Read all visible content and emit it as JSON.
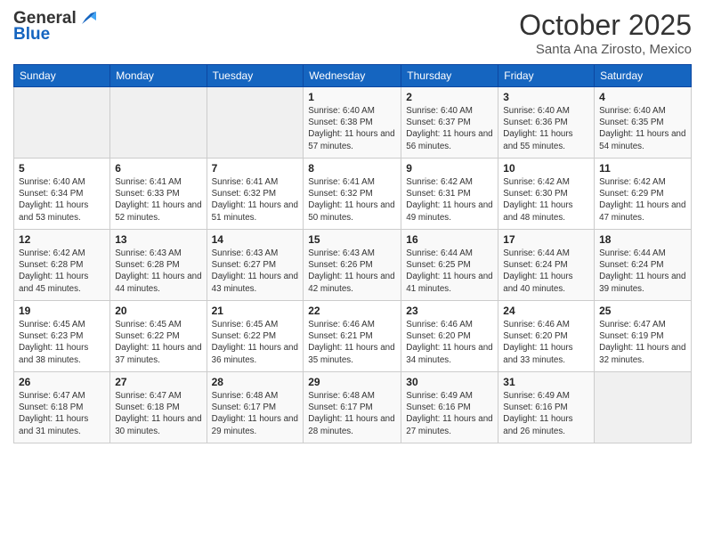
{
  "header": {
    "logo_line1": "General",
    "logo_line2": "Blue",
    "month": "October 2025",
    "location": "Santa Ana Zirosto, Mexico"
  },
  "weekdays": [
    "Sunday",
    "Monday",
    "Tuesday",
    "Wednesday",
    "Thursday",
    "Friday",
    "Saturday"
  ],
  "weeks": [
    [
      {
        "day": "",
        "sunrise": "",
        "sunset": "",
        "daylight": ""
      },
      {
        "day": "",
        "sunrise": "",
        "sunset": "",
        "daylight": ""
      },
      {
        "day": "",
        "sunrise": "",
        "sunset": "",
        "daylight": ""
      },
      {
        "day": "1",
        "sunrise": "Sunrise: 6:40 AM",
        "sunset": "Sunset: 6:38 PM",
        "daylight": "Daylight: 11 hours and 57 minutes."
      },
      {
        "day": "2",
        "sunrise": "Sunrise: 6:40 AM",
        "sunset": "Sunset: 6:37 PM",
        "daylight": "Daylight: 11 hours and 56 minutes."
      },
      {
        "day": "3",
        "sunrise": "Sunrise: 6:40 AM",
        "sunset": "Sunset: 6:36 PM",
        "daylight": "Daylight: 11 hours and 55 minutes."
      },
      {
        "day": "4",
        "sunrise": "Sunrise: 6:40 AM",
        "sunset": "Sunset: 6:35 PM",
        "daylight": "Daylight: 11 hours and 54 minutes."
      }
    ],
    [
      {
        "day": "5",
        "sunrise": "Sunrise: 6:40 AM",
        "sunset": "Sunset: 6:34 PM",
        "daylight": "Daylight: 11 hours and 53 minutes."
      },
      {
        "day": "6",
        "sunrise": "Sunrise: 6:41 AM",
        "sunset": "Sunset: 6:33 PM",
        "daylight": "Daylight: 11 hours and 52 minutes."
      },
      {
        "day": "7",
        "sunrise": "Sunrise: 6:41 AM",
        "sunset": "Sunset: 6:32 PM",
        "daylight": "Daylight: 11 hours and 51 minutes."
      },
      {
        "day": "8",
        "sunrise": "Sunrise: 6:41 AM",
        "sunset": "Sunset: 6:32 PM",
        "daylight": "Daylight: 11 hours and 50 minutes."
      },
      {
        "day": "9",
        "sunrise": "Sunrise: 6:42 AM",
        "sunset": "Sunset: 6:31 PM",
        "daylight": "Daylight: 11 hours and 49 minutes."
      },
      {
        "day": "10",
        "sunrise": "Sunrise: 6:42 AM",
        "sunset": "Sunset: 6:30 PM",
        "daylight": "Daylight: 11 hours and 48 minutes."
      },
      {
        "day": "11",
        "sunrise": "Sunrise: 6:42 AM",
        "sunset": "Sunset: 6:29 PM",
        "daylight": "Daylight: 11 hours and 47 minutes."
      }
    ],
    [
      {
        "day": "12",
        "sunrise": "Sunrise: 6:42 AM",
        "sunset": "Sunset: 6:28 PM",
        "daylight": "Daylight: 11 hours and 45 minutes."
      },
      {
        "day": "13",
        "sunrise": "Sunrise: 6:43 AM",
        "sunset": "Sunset: 6:28 PM",
        "daylight": "Daylight: 11 hours and 44 minutes."
      },
      {
        "day": "14",
        "sunrise": "Sunrise: 6:43 AM",
        "sunset": "Sunset: 6:27 PM",
        "daylight": "Daylight: 11 hours and 43 minutes."
      },
      {
        "day": "15",
        "sunrise": "Sunrise: 6:43 AM",
        "sunset": "Sunset: 6:26 PM",
        "daylight": "Daylight: 11 hours and 42 minutes."
      },
      {
        "day": "16",
        "sunrise": "Sunrise: 6:44 AM",
        "sunset": "Sunset: 6:25 PM",
        "daylight": "Daylight: 11 hours and 41 minutes."
      },
      {
        "day": "17",
        "sunrise": "Sunrise: 6:44 AM",
        "sunset": "Sunset: 6:24 PM",
        "daylight": "Daylight: 11 hours and 40 minutes."
      },
      {
        "day": "18",
        "sunrise": "Sunrise: 6:44 AM",
        "sunset": "Sunset: 6:24 PM",
        "daylight": "Daylight: 11 hours and 39 minutes."
      }
    ],
    [
      {
        "day": "19",
        "sunrise": "Sunrise: 6:45 AM",
        "sunset": "Sunset: 6:23 PM",
        "daylight": "Daylight: 11 hours and 38 minutes."
      },
      {
        "day": "20",
        "sunrise": "Sunrise: 6:45 AM",
        "sunset": "Sunset: 6:22 PM",
        "daylight": "Daylight: 11 hours and 37 minutes."
      },
      {
        "day": "21",
        "sunrise": "Sunrise: 6:45 AM",
        "sunset": "Sunset: 6:22 PM",
        "daylight": "Daylight: 11 hours and 36 minutes."
      },
      {
        "day": "22",
        "sunrise": "Sunrise: 6:46 AM",
        "sunset": "Sunset: 6:21 PM",
        "daylight": "Daylight: 11 hours and 35 minutes."
      },
      {
        "day": "23",
        "sunrise": "Sunrise: 6:46 AM",
        "sunset": "Sunset: 6:20 PM",
        "daylight": "Daylight: 11 hours and 34 minutes."
      },
      {
        "day": "24",
        "sunrise": "Sunrise: 6:46 AM",
        "sunset": "Sunset: 6:20 PM",
        "daylight": "Daylight: 11 hours and 33 minutes."
      },
      {
        "day": "25",
        "sunrise": "Sunrise: 6:47 AM",
        "sunset": "Sunset: 6:19 PM",
        "daylight": "Daylight: 11 hours and 32 minutes."
      }
    ],
    [
      {
        "day": "26",
        "sunrise": "Sunrise: 6:47 AM",
        "sunset": "Sunset: 6:18 PM",
        "daylight": "Daylight: 11 hours and 31 minutes."
      },
      {
        "day": "27",
        "sunrise": "Sunrise: 6:47 AM",
        "sunset": "Sunset: 6:18 PM",
        "daylight": "Daylight: 11 hours and 30 minutes."
      },
      {
        "day": "28",
        "sunrise": "Sunrise: 6:48 AM",
        "sunset": "Sunset: 6:17 PM",
        "daylight": "Daylight: 11 hours and 29 minutes."
      },
      {
        "day": "29",
        "sunrise": "Sunrise: 6:48 AM",
        "sunset": "Sunset: 6:17 PM",
        "daylight": "Daylight: 11 hours and 28 minutes."
      },
      {
        "day": "30",
        "sunrise": "Sunrise: 6:49 AM",
        "sunset": "Sunset: 6:16 PM",
        "daylight": "Daylight: 11 hours and 27 minutes."
      },
      {
        "day": "31",
        "sunrise": "Sunrise: 6:49 AM",
        "sunset": "Sunset: 6:16 PM",
        "daylight": "Daylight: 11 hours and 26 minutes."
      },
      {
        "day": "",
        "sunrise": "",
        "sunset": "",
        "daylight": ""
      }
    ]
  ]
}
